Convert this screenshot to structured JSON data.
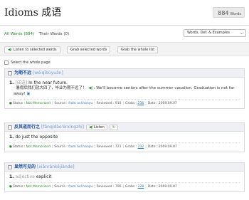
{
  "header": {
    "title": "Idioms 成语",
    "count": "884",
    "count_unit": "Words"
  },
  "tabs": [
    {
      "label": "All Words (884)"
    },
    {
      "label": "Their Words (0)"
    }
  ],
  "sort_select": {
    "value": "Words, Def. & Examples"
  },
  "actions": {
    "listen_label": "Listen to selected words",
    "grab_selected_label": "Grab selected words",
    "grab_whole_label": "Grab the whole list"
  },
  "select_page_label": "Select the whole page",
  "meta_labels": {
    "status": "Status :",
    "source": "Source :",
    "reviewed": "Reviewed :",
    "grabs": "Grabs :",
    "date": "Date :"
  },
  "cards": [
    {
      "word": "为期不远",
      "pinyin": "[wéiqībùyuǎn]",
      "def_num": "1.",
      "def_tag": "[成语]",
      "definition": "In the near future.",
      "example_cn": "· 暑假后我们就大四了，毕业为期不远了！",
      "example_en": ": We'll become seniors after the summer vacation. Graduation is not far away!",
      "status": "Not Memorized",
      "source": "from avl.hanyu",
      "reviewed": "910",
      "grabs": "236",
      "date": "2009.09.07"
    },
    {
      "word": "反其道而行之",
      "pinyin": "[fǎnqídào'érxíngzhī]",
      "listen_label": "Listen",
      "def_num": "1.",
      "definition": "do just the opposite",
      "status": "Not Memorized",
      "source": "from avl.hanyu",
      "reviewed": "721",
      "grabs": "232",
      "date": "2009.09.07"
    },
    {
      "word": "显然可见的",
      "pinyin": "[xiǎnránkějiànde]",
      "def_num": "1.",
      "def_tag": "adjective",
      "definition": "explicit",
      "status": "Not Memorized",
      "source": "from avl.hanyu",
      "reviewed": "796",
      "grabs": "228",
      "date": "2009.09.07"
    }
  ]
}
